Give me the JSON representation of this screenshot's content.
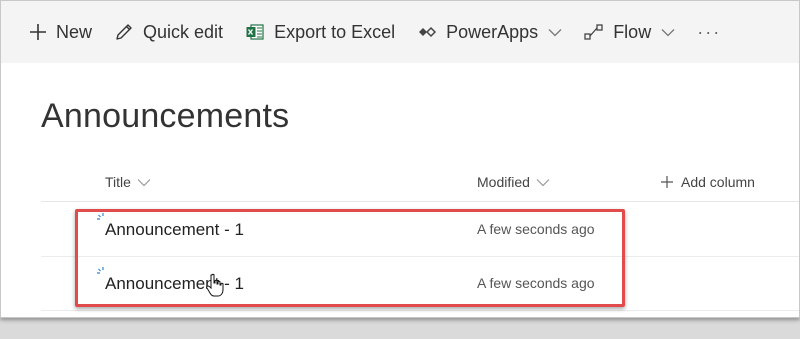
{
  "commandbar": {
    "new_label": "New",
    "quick_edit_label": "Quick edit",
    "export_label": "Export to Excel",
    "powerapps_label": "PowerApps",
    "flow_label": "Flow",
    "more_label": "···"
  },
  "page": {
    "title": "Announcements"
  },
  "list": {
    "columns": {
      "title": "Title",
      "modified": "Modified",
      "add_column": "Add column"
    },
    "rows": [
      {
        "title": "Announcement - 1",
        "modified": "A few seconds ago"
      },
      {
        "title": "Announcement - 1",
        "modified": "A few seconds ago"
      }
    ]
  },
  "colors": {
    "accent": "#0078d4",
    "excel": "#217346",
    "highlight": "#e04b4b"
  },
  "icons": {
    "new": "plus-icon",
    "quick_edit": "pencil-icon",
    "export": "excel-icon",
    "powerapps": "powerapps-icon",
    "flow": "flow-icon",
    "more": "ellipsis-icon",
    "add_column": "plus-icon",
    "row_state": "loading-spinner-icon",
    "pointer": "hand-cursor-icon"
  }
}
